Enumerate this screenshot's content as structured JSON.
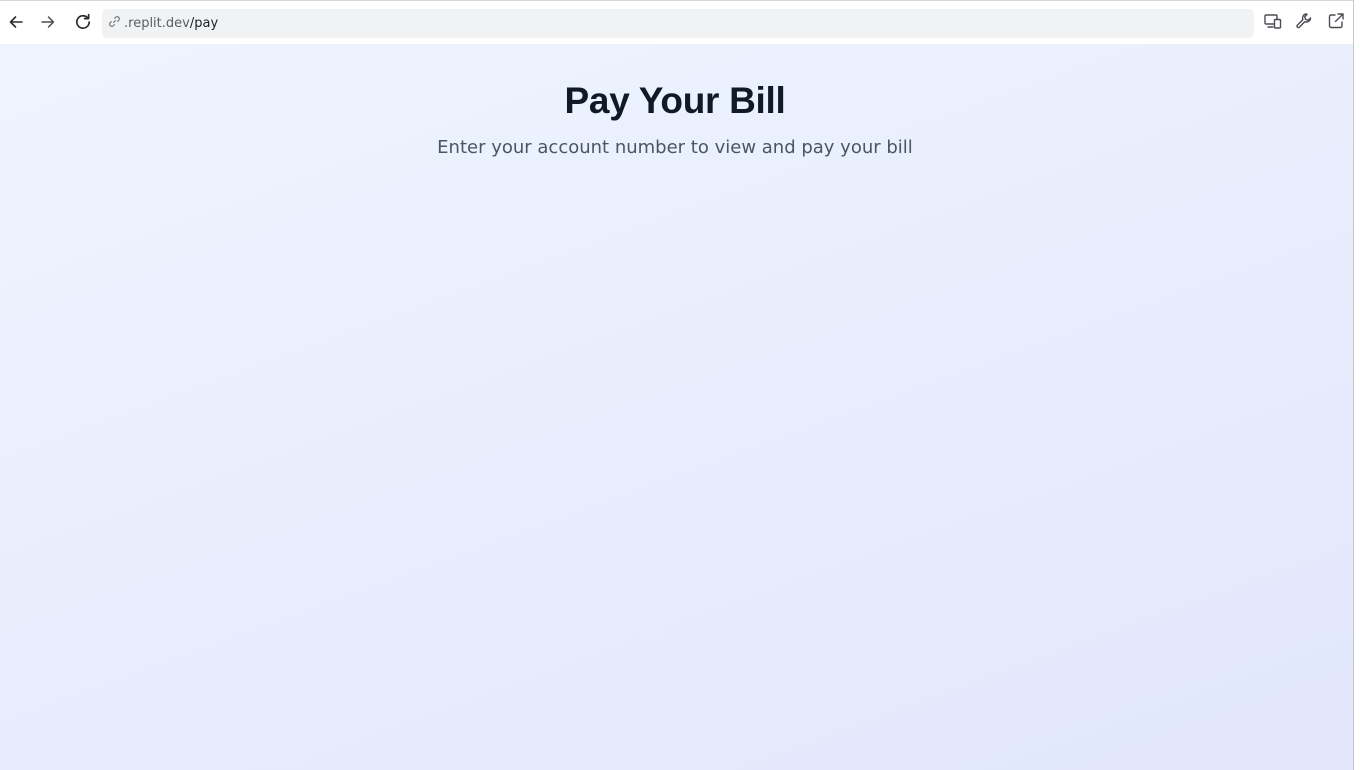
{
  "browser": {
    "url_host": ".replit.dev",
    "url_path": "/pay",
    "icons": {
      "back": "arrow-left-icon",
      "forward": "arrow-right-icon",
      "reload": "reload-icon",
      "link": "link-icon",
      "devices": "responsive-devices-icon",
      "devtools": "wrench-icon",
      "open_external": "external-link-icon"
    }
  },
  "page": {
    "title": "Pay Your Bill",
    "subtitle": "Enter your account number to view and pay your bill"
  },
  "colors": {
    "background_start": "#eef4ff",
    "background_end": "#e1e6fc",
    "title": "#111827",
    "subtitle": "#4b5563",
    "address_bar": "#f1f2f4"
  }
}
